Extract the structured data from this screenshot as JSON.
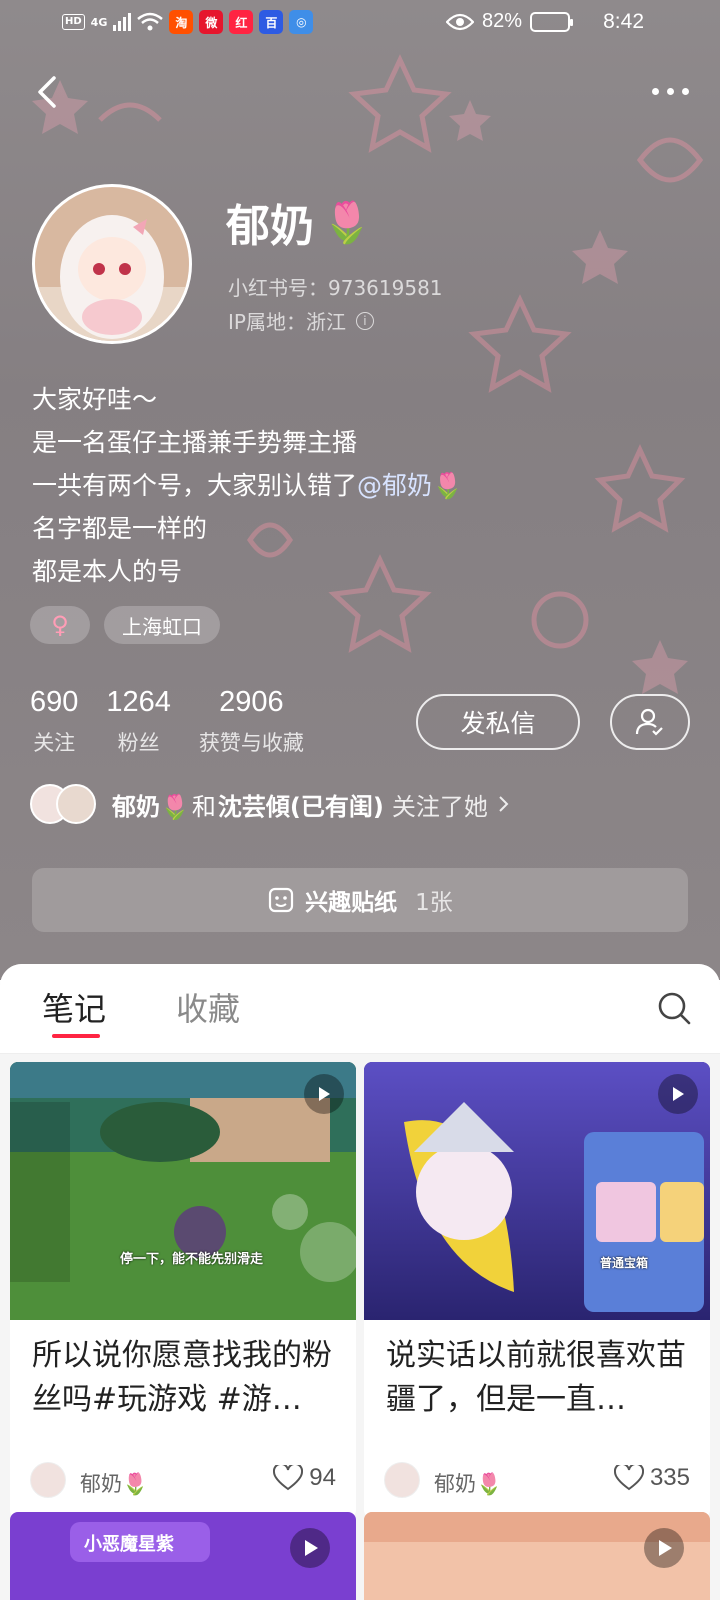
{
  "status_bar": {
    "network_tag": "HD",
    "network_type": "4G",
    "battery_percent": "82%",
    "time": "8:42",
    "apps": [
      "taobao-icon",
      "weibo-icon",
      "xiaohongshu-icon",
      "baidu-icon",
      "browser-icon"
    ]
  },
  "profile": {
    "nickname": "郁奶",
    "nickname_emoji": "🌷",
    "red_id": "小红书号：973619581",
    "ip_location": "IP属地：浙江",
    "bio_lines": [
      "大家好哇～",
      "是一名蛋仔主播兼手势舞主播",
      "一共有两个号，大家别认错了",
      "名字都是一样的",
      "都是本人的号"
    ],
    "bio_mention": "@郁奶🌷",
    "gender_symbol": "♀",
    "location_tag": "上海虹口",
    "stats": [
      {
        "value": "690",
        "label": "关注"
      },
      {
        "value": "1264",
        "label": "粉丝"
      },
      {
        "value": "2906",
        "label": "获赞与收藏"
      }
    ],
    "message_button": "发私信",
    "mutual": {
      "name1": "郁奶🌷",
      "connector": "和",
      "name2": "沈芸傾(已有闺)",
      "suffix": "关注了她"
    },
    "sticker_label": "兴趣贴纸",
    "sticker_count": "1张"
  },
  "tabs": [
    {
      "label": "笔记",
      "active": true
    },
    {
      "label": "收藏",
      "active": false
    }
  ],
  "notes": [
    {
      "title": "所以说你愿意找我的粉丝吗#玩游戏 #游…",
      "author": "郁奶🌷",
      "likes": "94",
      "overlay_text": "停一下，能不能先别滑走"
    },
    {
      "title": "说实话以前就很喜欢苗疆了，但是一直…",
      "author": "郁奶🌷",
      "likes": "335",
      "overlay_text": "普通宝箱"
    },
    {
      "title": "",
      "author": "",
      "likes": "",
      "overlay_text": "小恶魔星紫"
    },
    {
      "title": "",
      "author": "",
      "likes": "",
      "overlay_text": ""
    }
  ],
  "colors": {
    "accent": "#ff2442",
    "header_bg": "#8a8486",
    "mention": "#d8e3ff"
  }
}
